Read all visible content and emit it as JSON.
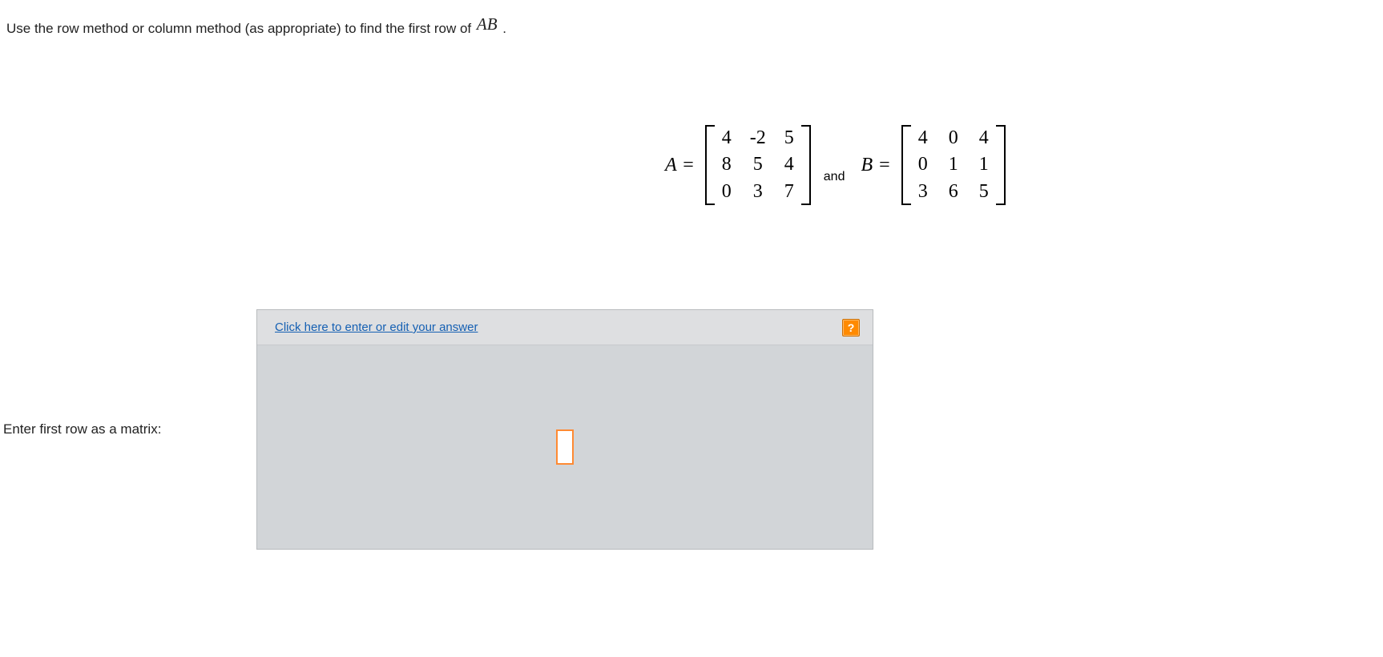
{
  "question": {
    "prefix": "Use the row method or column method (as appropriate) to find the first row of ",
    "expr": "AB",
    "suffix": " ."
  },
  "matrices": {
    "a_label": "A",
    "eq": "=",
    "a": [
      [
        "4",
        "-2",
        "5"
      ],
      [
        "8",
        "5",
        "4"
      ],
      [
        "0",
        "3",
        "7"
      ]
    ],
    "and": "and",
    "b_label": "B",
    "b": [
      [
        "4",
        "0",
        "4"
      ],
      [
        "0",
        "1",
        "1"
      ],
      [
        "3",
        "6",
        "5"
      ]
    ]
  },
  "answer": {
    "label": "Enter first row as a matrix:",
    "link": "Click here to enter or edit your answer",
    "help": "?"
  }
}
